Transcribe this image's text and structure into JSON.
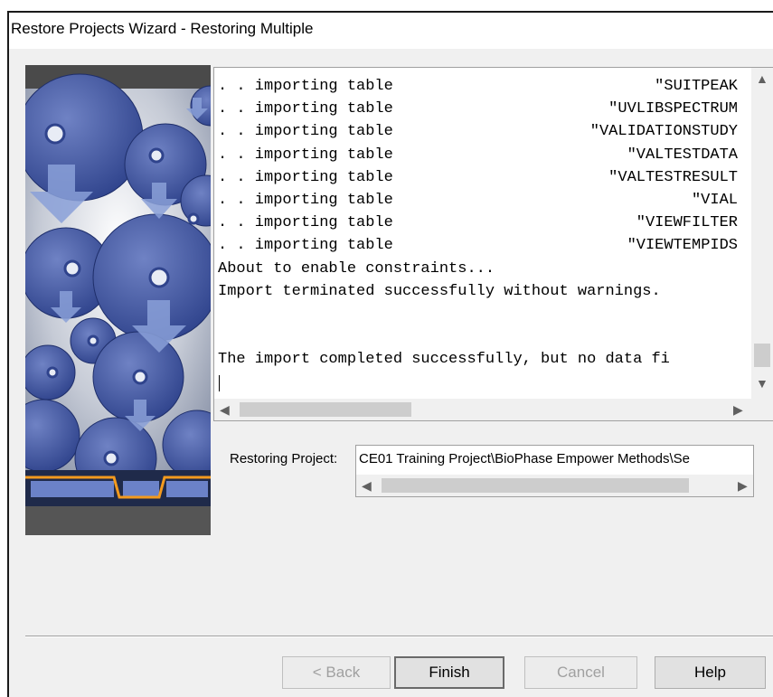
{
  "window": {
    "title": "Restore Projects Wizard - Restoring Multiple"
  },
  "log": {
    "lines": [
      {
        "prefix": ". . importing table",
        "name": "\"SUITPEAK"
      },
      {
        "prefix": ". . importing table",
        "name": "\"UVLIBSPECTRUM"
      },
      {
        "prefix": ". . importing table",
        "name": "\"VALIDATIONSTUDY"
      },
      {
        "prefix": ". . importing table",
        "name": "\"VALTESTDATA"
      },
      {
        "prefix": ". . importing table",
        "name": "\"VALTESTRESULT"
      },
      {
        "prefix": ". . importing table",
        "name": "\"VIAL"
      },
      {
        "prefix": ". . importing table",
        "name": "\"VIEWFILTER"
      },
      {
        "prefix": ". . importing table",
        "name": "\"VIEWTEMPIDS"
      },
      {
        "prefix": "About to enable constraints...",
        "name": ""
      },
      {
        "prefix": "Import terminated successfully without warnings.",
        "name": ""
      },
      {
        "prefix": "",
        "name": ""
      },
      {
        "prefix": "",
        "name": ""
      },
      {
        "prefix": "The import completed successfully, but no data fi",
        "name": ""
      },
      {
        "prefix": "",
        "name": ""
      }
    ]
  },
  "restoring": {
    "label": "Restoring Project:",
    "value": "CE01 Training Project\\BioPhase Empower Methods\\Se"
  },
  "buttons": {
    "back": "< Back",
    "finish": "Finish",
    "cancel": "Cancel",
    "help": "Help"
  },
  "colors": {
    "window_bg": "#f0f0f0",
    "disc_blue": "#3f55a0",
    "accent_orange": "#f39a1e"
  },
  "icons": {
    "scroll_up": "▲",
    "scroll_down": "▼",
    "scroll_left": "◀",
    "scroll_right": "▶"
  }
}
